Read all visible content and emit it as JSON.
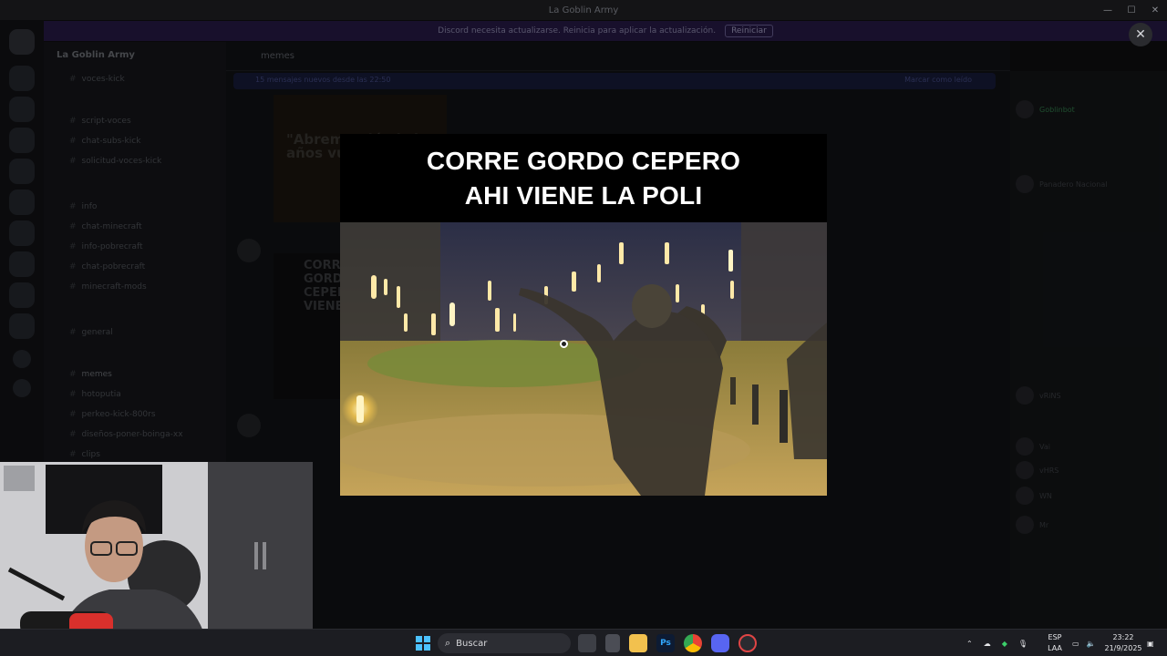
{
  "window": {
    "title": "La Goblin Army",
    "controls": [
      "—",
      "☐",
      "✕"
    ]
  },
  "banner": {
    "text": "Discord necesita actualizarse. Reinicia para aplicar la actualización.",
    "button": "Reiniciar"
  },
  "sidebar": {
    "guild_name": "La Goblin Army",
    "channels": [
      "voces-kick",
      "script-voces",
      "chat-subs-kick",
      "solicitud-voces-kick",
      "info",
      "chat-minecraft",
      "info-pobrecraft",
      "chat-pobrecraft",
      "minecraft-mods",
      "general",
      "memes",
      "hotoputia",
      "perkeo-kick-800rs",
      "diseños-poner-boinga-xx",
      "clips"
    ]
  },
  "chat": {
    "channel": "memes",
    "new_messages": "15 mensajes nuevos desde las 22:50",
    "mark_read": "Marcar como leído",
    "thumb_text": "\"Abrem polémic los años vuelve c",
    "embed_text": "CORRE GORDO CEPERO AHI VIENE LA POLI"
  },
  "members": {
    "items": [
      "Goblinbot",
      "Panadero Nacional",
      "vRiNS",
      "Vai",
      "vHRS",
      "WN",
      "Mr"
    ]
  },
  "viewer": {
    "caption_line1": "CORRE GORDO CEPERO",
    "caption_line2": "AHI VIENE LA POLI",
    "close": "✕"
  },
  "taskbar": {
    "search_label": "Buscar",
    "lang_line1": "ESP",
    "lang_line2": "LAA",
    "time": "23:22",
    "date": "21/9/2025"
  },
  "colors": {
    "discord_blurple": "#5865f2",
    "win_accent": "#0078d4",
    "streetlight": "#ffe9a8"
  }
}
